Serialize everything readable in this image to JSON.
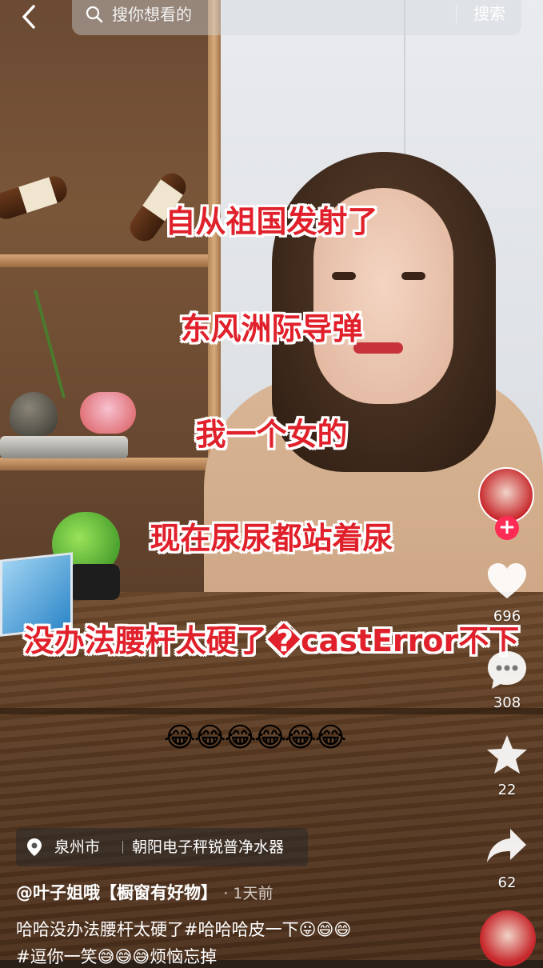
{
  "topbar": {
    "back_icon": "chevron-left-icon",
    "search_icon": "search-icon",
    "search_placeholder": "搜你想看的",
    "search_button": "搜索"
  },
  "captions": [
    "自从祖国发射了",
    "东风洲际导弹",
    "我一个女的",
    "现在尿尿都站着尿",
    "没办法腰杆太硬了�castError不下"
  ],
  "emoji_row": "😂😂😂😂😂😂",
  "right_rail": {
    "avatar_icon": "creator-avatar",
    "follow_label": "+",
    "like_icon": "heart-icon",
    "like_count": "696",
    "comment_icon": "comment-icon",
    "comment_count": "308",
    "favorite_icon": "star-icon",
    "favorite_count": "22",
    "share_icon": "share-icon",
    "share_count": "62"
  },
  "location": {
    "pin_icon": "location-pin-icon",
    "city": "泉州市",
    "shop": "朝阳电子秤锐普净水器"
  },
  "post": {
    "author": "@叶子姐哦【橱窗有好物】",
    "time": "· 1天前",
    "description_line1": "哈哈没办法腰杆太硬了#哈哈哈皮一下😛😄😄",
    "description_line2": "#逗你一笑😅😅😅烦恼忘掉"
  },
  "colors": {
    "caption_red": "#e0202a",
    "follow_pink": "#fe2c55"
  }
}
